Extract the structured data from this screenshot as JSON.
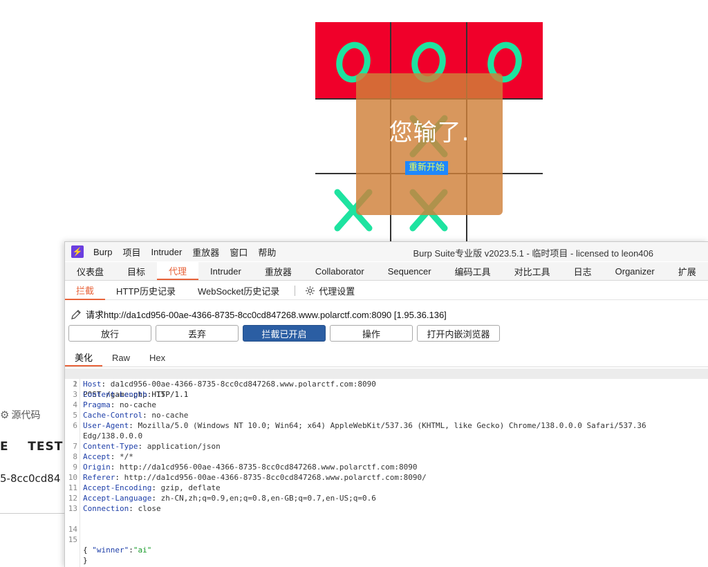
{
  "game": {
    "cells": [
      "O",
      "O",
      "O",
      "",
      "X",
      "",
      "X",
      "X",
      ""
    ],
    "colors": {
      "win_row": "#f0002a",
      "mark": "#1ee3a0",
      "overlay": "#cf8039",
      "restart_bg": "#1e88ff",
      "restart_text": "#e9fb59"
    },
    "overlay_message": "您输了.",
    "restart_label": "重新开始"
  },
  "background_browser": {
    "source_label": "源代码",
    "tabs_text": "E    TEST",
    "url_fragment": "5-8cc0cd84"
  },
  "burp": {
    "menu": [
      "Burp",
      "项目",
      "Intruder",
      "重放器",
      "窗口",
      "帮助"
    ],
    "window_title": "Burp Suite专业版  v2023.5.1 - 临时项目 - licensed to leon406",
    "main_tabs": [
      "仪表盘",
      "目标",
      "代理",
      "Intruder",
      "重放器",
      "Collaborator",
      "Sequencer",
      "编码工具",
      "对比工具",
      "日志",
      "Organizer",
      "扩展"
    ],
    "active_main_tab": "代理",
    "sub_tabs": [
      "拦截",
      "HTTP历史记录",
      "WebSocket历史记录"
    ],
    "proxy_settings_label": "代理设置",
    "request_line": "请求http://da1cd956-00ae-4366-8735-8cc0cd847268.www.polarctf.com:8090  [1.95.36.136]",
    "buttons": {
      "forward": "放行",
      "drop": "丢弃",
      "intercept": "拦截已开启",
      "action": "操作",
      "browser": "打开内嵌浏览器"
    },
    "view_tabs": [
      "美化",
      "Raw",
      "Hex"
    ],
    "request_line_start": "POST /game.php HTTP/1.1",
    "headers": [
      {
        "num": "2",
        "name": "Host",
        "value": " da1cd956-00ae-4366-8735-8cc0cd847268.www.polarctf.com:8090"
      },
      {
        "num": "3",
        "name": "Content-Length",
        "value": " 15"
      },
      {
        "num": "4",
        "name": "Pragma",
        "value": " no-cache"
      },
      {
        "num": "5",
        "name": "Cache-Control",
        "value": " no-cache"
      },
      {
        "num": "6",
        "name": "User-Agent",
        "value": " Mozilla/5.0 (Windows NT 10.0; Win64; x64) AppleWebKit/537.36 (KHTML, like Gecko) Chrome/138.0.0.0 Safari/537.36"
      },
      {
        "num": "",
        "name": "",
        "value": "Edg/138.0.0.0"
      },
      {
        "num": "7",
        "name": "Content-Type",
        "value": " application/json"
      },
      {
        "num": "8",
        "name": "Accept",
        "value": " */*"
      },
      {
        "num": "9",
        "name": "Origin",
        "value": " http://da1cd956-00ae-4366-8735-8cc0cd847268.www.polarctf.com:8090"
      },
      {
        "num": "10",
        "name": "Referer",
        "value": " http://da1cd956-00ae-4366-8735-8cc0cd847268.www.polarctf.com:8090/"
      },
      {
        "num": "11",
        "name": "Accept-Encoding",
        "value": " gzip, deflate"
      },
      {
        "num": "12",
        "name": "Accept-Language",
        "value": " zh-CN,zh;q=0.9,en;q=0.8,en-GB;q=0.7,en-US;q=0.6"
      },
      {
        "num": "13",
        "name": "Connection",
        "value": " close"
      }
    ],
    "body": {
      "open": "{",
      "key": "\"winner\"",
      "value": "\"ai\"",
      "close": "}"
    }
  }
}
